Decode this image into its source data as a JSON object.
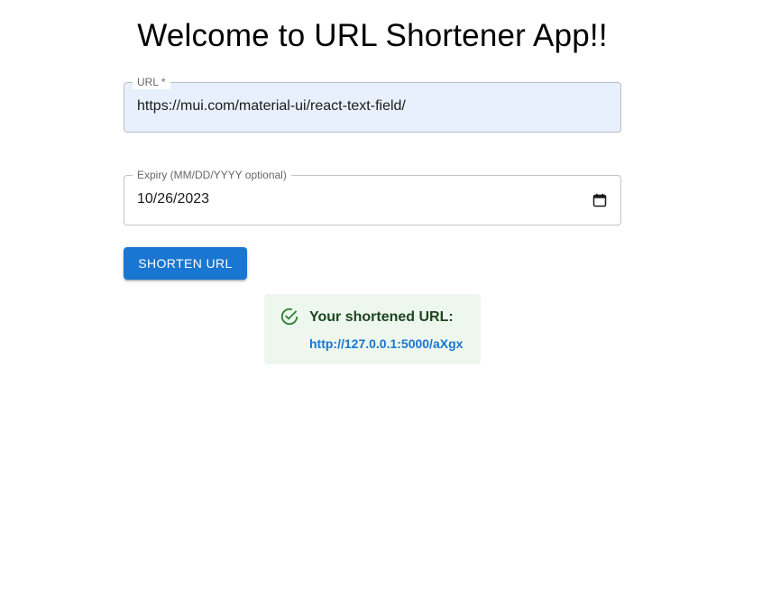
{
  "header": {
    "title": "Welcome to URL Shortener App!!"
  },
  "url_field": {
    "label": "URL *",
    "value": "https://mui.com/material-ui/react-text-field/"
  },
  "expiry_field": {
    "label": "Expiry (MM/DD/YYYY optional)",
    "value": "10/26/2023",
    "icon": "calendar-icon"
  },
  "actions": {
    "shorten_label": "SHORTEN URL"
  },
  "result_alert": {
    "icon": "check-circle-icon",
    "title": "Your shortened URL:",
    "link": "http://127.0.0.1:5000/aXgx"
  },
  "colors": {
    "primary": "#1976d2",
    "success_bg": "#edf7ed",
    "success_text": "#1e4620",
    "success_icon": "#2e7d32",
    "autofill_bg": "#e8f0fe"
  }
}
